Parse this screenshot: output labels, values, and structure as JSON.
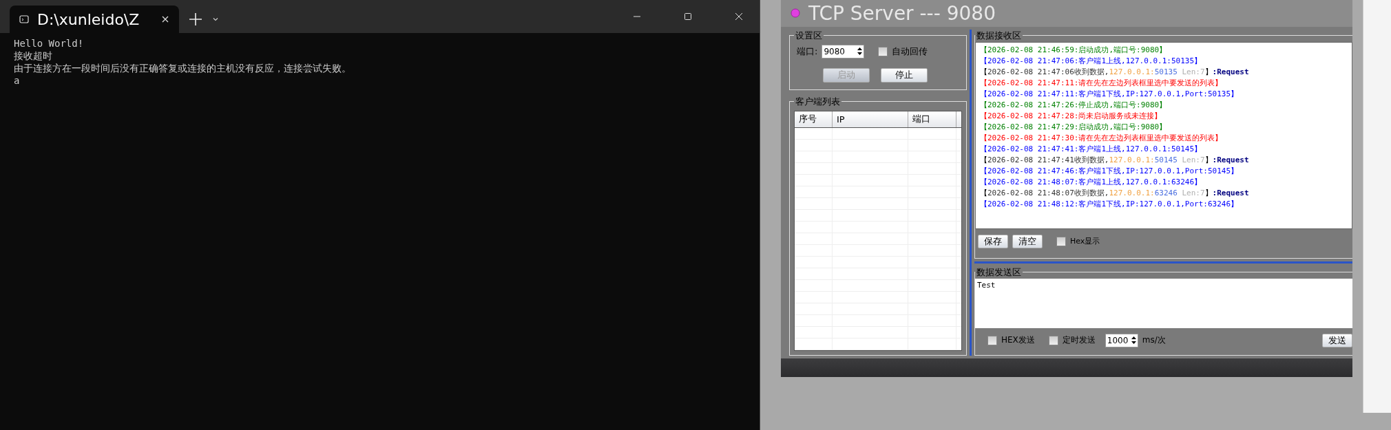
{
  "terminal": {
    "tab": {
      "title": "D:\\xunleido\\Z",
      "selected": true
    },
    "lines": [
      "Hello World!",
      "接收超时",
      "由于连接方在一段时间后没有正确答复或连接的主机没有反应，连接尝试失败。",
      "a"
    ]
  },
  "tcp_server": {
    "title": "TCP Server --- 9080",
    "settings": {
      "title": "设置区",
      "port_label": "端口:",
      "port_value": "9080",
      "auto_echo": {
        "label": "自动回传",
        "checked": false
      },
      "buttons": [
        {
          "label": "启动",
          "disabled": true
        },
        {
          "label": "停止",
          "disabled": false
        }
      ]
    },
    "clients": {
      "title": "客户端列表",
      "columns": [
        "序号",
        "IP",
        "端口"
      ]
    },
    "receive": {
      "title": "数据接收区",
      "lines": [
        [
          {
            "text": "【",
            "color": "#008000"
          },
          {
            "text": "2026-02-08 21:46:59:启动成功,端口号:9080",
            "color": "#008000"
          },
          {
            "text": "】",
            "color": "#008000"
          }
        ],
        [
          {
            "text": "【",
            "color": "#0000ff"
          },
          {
            "text": "2026-02-08 21:47:06:客户端1上线,127.0.0.1:50135",
            "color": "#0000ff"
          },
          {
            "text": "】",
            "color": "#0000ff"
          }
        ],
        [
          {
            "text": "【",
            "color": "#000000"
          },
          {
            "text": "2026-02-08 21:47:06收到数据,",
            "color": "#333333"
          },
          {
            "text": "127.0.0.1:",
            "color": "#f0a040"
          },
          {
            "text": "50135",
            "color": "#4a6ee0"
          },
          {
            "text": " Len:7",
            "color": "#b0b0b0"
          },
          {
            "text": "】",
            "color": "#000000"
          },
          {
            "text": ":Request",
            "color": "#000080"
          }
        ],
        [
          {
            "text": "【",
            "color": "#ff0000"
          },
          {
            "text": "2026-02-08 21:47:11:请在先在左边列表框里选中要发送的列表",
            "color": "#ff0000"
          },
          {
            "text": "】",
            "color": "#ff0000"
          }
        ],
        [
          {
            "text": "【",
            "color": "#0000ff"
          },
          {
            "text": "2026-02-08 21:47:11:客户端1下线,IP:127.0.0.1,Port:50135",
            "color": "#0000ff"
          },
          {
            "text": "】",
            "color": "#0000ff"
          }
        ],
        [
          {
            "text": "【",
            "color": "#008000"
          },
          {
            "text": "2026-02-08 21:47:26:停止成功,端口号:9080",
            "color": "#008000"
          },
          {
            "text": "】",
            "color": "#008000"
          }
        ],
        [
          {
            "text": "【",
            "color": "#ff0000"
          },
          {
            "text": "2026-02-08 21:47:28:尚未启动服务或未连接",
            "color": "#ff0000"
          },
          {
            "text": "】",
            "color": "#ff0000"
          }
        ],
        [
          {
            "text": "【",
            "color": "#008000"
          },
          {
            "text": "2026-02-08 21:47:29:启动成功,端口号:9080",
            "color": "#008000"
          },
          {
            "text": "】",
            "color": "#008000"
          }
        ],
        [
          {
            "text": "【",
            "color": "#ff0000"
          },
          {
            "text": "2026-02-08 21:47:30:请在先在左边列表框里选中要发送的列表",
            "color": "#ff0000"
          },
          {
            "text": "】",
            "color": "#ff0000"
          }
        ],
        [
          {
            "text": "【",
            "color": "#0000ff"
          },
          {
            "text": "2026-02-08 21:47:41:客户端1上线,127.0.0.1:50145",
            "color": "#0000ff"
          },
          {
            "text": "】",
            "color": "#0000ff"
          }
        ],
        [
          {
            "text": "【",
            "color": "#000000"
          },
          {
            "text": "2026-02-08 21:47:41收到数据,",
            "color": "#333333"
          },
          {
            "text": "127.0.0.1:",
            "color": "#f0a040"
          },
          {
            "text": "50145",
            "color": "#4a6ee0"
          },
          {
            "text": " Len:7",
            "color": "#b0b0b0"
          },
          {
            "text": "】",
            "color": "#000000"
          },
          {
            "text": ":Request",
            "color": "#000080"
          }
        ],
        [
          {
            "text": "【",
            "color": "#0000ff"
          },
          {
            "text": "2026-02-08 21:47:46:客户端1下线,IP:127.0.0.1,Port:50145",
            "color": "#0000ff"
          },
          {
            "text": "】",
            "color": "#0000ff"
          }
        ],
        [
          {
            "text": "【",
            "color": "#0000ff"
          },
          {
            "text": "2026-02-08 21:48:07:客户端1上线,127.0.0.1:63246",
            "color": "#0000ff"
          },
          {
            "text": "】",
            "color": "#0000ff"
          }
        ],
        [
          {
            "text": "【",
            "color": "#000000"
          },
          {
            "text": "2026-02-08 21:48:07收到数据,",
            "color": "#333333"
          },
          {
            "text": "127.0.0.1:",
            "color": "#f0a040"
          },
          {
            "text": "63246",
            "color": "#4a6ee0"
          },
          {
            "text": " Len:7",
            "color": "#b0b0b0"
          },
          {
            "text": "】",
            "color": "#000000"
          },
          {
            "text": ":Request",
            "color": "#000080"
          }
        ],
        [
          {
            "text": "【",
            "color": "#0000ff"
          },
          {
            "text": "2026-02-08 21:48:12:客户端1下线,IP:127.0.0.1,Port:63246",
            "color": "#0000ff"
          },
          {
            "text": "】",
            "color": "#0000ff"
          }
        ]
      ],
      "buttons": [
        "保存",
        "清空"
      ],
      "hex_display": {
        "label": "Hex显示",
        "checked": false
      }
    },
    "send": {
      "title": "数据发送区",
      "value": "Test",
      "hex_send": {
        "label": "HEX发送",
        "checked": false
      },
      "timed_send": {
        "label": "定时发送",
        "checked": false
      },
      "interval": "1000",
      "unit": "ms/次",
      "send_button": "发送"
    }
  }
}
